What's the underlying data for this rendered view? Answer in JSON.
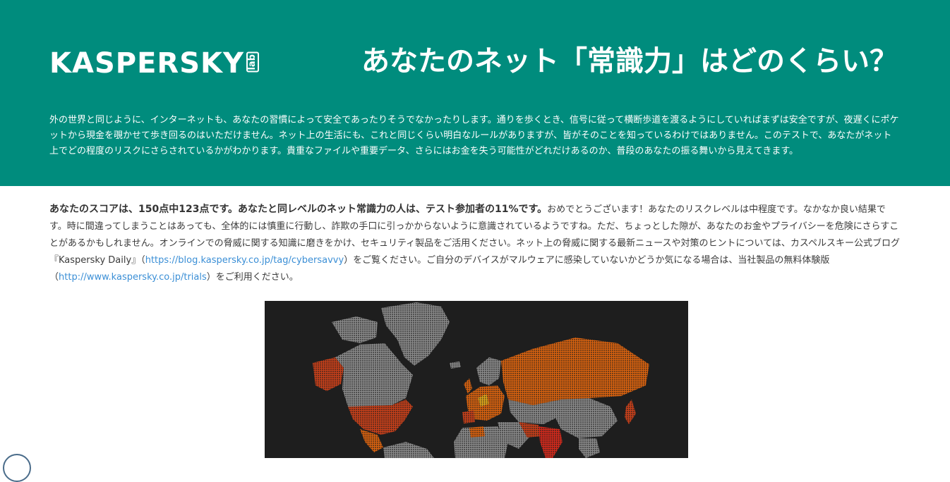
{
  "header": {
    "logo_word": "KASPERSKY",
    "logo_lab": "lab",
    "headline": "あなたのネット「常識力」はどのくらい？",
    "intro": "外の世界と同じように、インターネットも、あなたの習慣によって安全であったりそうでなかったりします。通りを歩くとき、信号に従って横断歩道を渡るようにしていればまずは安全ですが、夜遅くにポケットから現金を覗かせて歩き回るのはいただけません。ネット上の生活にも、これと同じくらい明白なルールがありますが、皆がそのことを知っているわけではありません。このテストで、あなたがネット上でどの程度のリスクにさらされているかがわかります。貴重なファイルや重要データ、さらにはお金を失う可能性がどれだけあるのか、普段のあなたの振る舞いから見えてきます。"
  },
  "result": {
    "score_sentence": "あなたのスコアは、150点中123点です。あなたと同レベルのネット常識力の人は、テスト参加者の11%です。",
    "body_1": "おめでとうございます！あなたのリスクレベルは中程度です。なかなか良い結果です。時に間違ってしまうことはあっても、全体的には慎重に行動し、詐欺の手口に引っかからないように意識されているようですね。ただ、ちょっとした隙が、あなたのお金やプライバシーを危険にさらすことがあるかもしれません。オンラインでの脅威に関する知識に磨きをかけ、セキュリティ製品をご活用ください。ネット上の脅威に関する最新ニュースや対策のヒントについては、カスペルスキー公式ブログ『Kaspersky Daily』（",
    "blog_link": "https://blog.kaspersky.co.jp/tag/cybersavvy",
    "body_2": "）をご覧ください。ご自分のデバイスがマルウェアに感染していないかどうか気になる場合は、当社製品の無料体験版（",
    "trial_link": "http://www.kaspersky.co.jp/trials",
    "body_3": "）をご利用ください。"
  },
  "map": {
    "background": "#1e1e1e",
    "land_color": "#8a8a8a",
    "orange": "#d9620f",
    "red_orange": "#c7401a",
    "red": "#d42a1c",
    "yellow": "#e3a81a",
    "highlight_regions": [
      "russia",
      "usa",
      "europe",
      "india",
      "brazil",
      "alaska"
    ]
  },
  "colors": {
    "header_bg": "#008c7d",
    "link": "#3b8fd6"
  }
}
